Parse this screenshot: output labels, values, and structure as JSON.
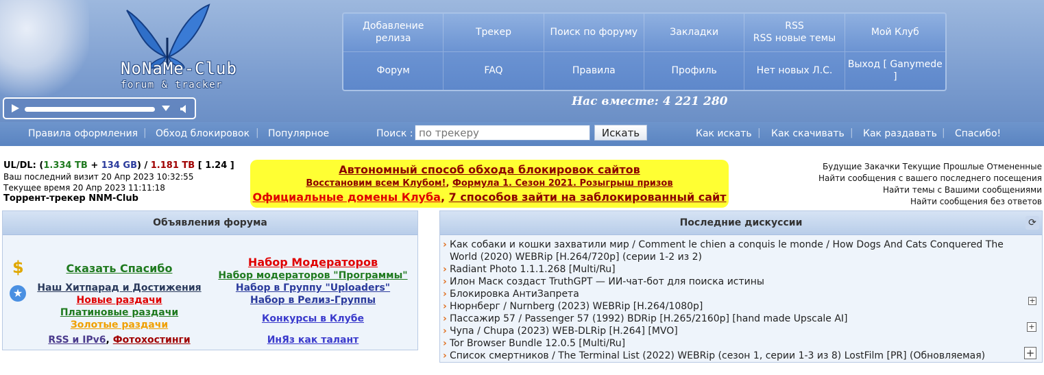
{
  "logo": {
    "title": "NoNaMe-Club",
    "subtitle": "forum & tracker"
  },
  "nav": [
    {
      "label": "Добавление релиза"
    },
    {
      "label": "Трекер"
    },
    {
      "label": "Поиск по форуму"
    },
    {
      "label": "Закладки"
    },
    {
      "label": "RSS\nRSS новые темы"
    },
    {
      "label": "Мой Клуб"
    },
    {
      "label": "Форум"
    },
    {
      "label": "FAQ"
    },
    {
      "label": "Правила"
    },
    {
      "label": "Профиль"
    },
    {
      "label": "Нет новых Л.С."
    },
    {
      "label": "Выход [ Ganymede ]"
    }
  ],
  "together": "Нас вместе: 4 221 280",
  "subbar": {
    "links_left": [
      "Правила оформления",
      "Обход блокировок",
      "Популярное"
    ],
    "search_label": "Поиск :",
    "search_placeholder": "по трекеру",
    "search_button": "Искать",
    "links_right": [
      "Как искать",
      "Как скачивать",
      "Как раздавать",
      "Спасибо!"
    ]
  },
  "user": {
    "ratio_label": "UL/DL:",
    "ul": "1.334 TB",
    "plus": "+",
    "bonus": "134 GB",
    "dl": "1.181 TB",
    "ratio": "1.24",
    "last_visit": "Ваш последний визит 20 Апр 2023 10:32:55",
    "current_time": "Текущее время 20 Апр 2023 11:11:18",
    "tracker_name": "Торрент-трекер NNM-Club"
  },
  "banner": {
    "line1": "Автономный способ обхода блокировок сайтов",
    "line2a": "Восстановим всем Клубом!",
    "line2b": "Формула 1. Сезон 2021. Розыгрыш призов",
    "line3a": "Официальные домены Клуба",
    "line3b": "7 способов зайти на заблокированный сайт"
  },
  "right_links": {
    "downloads": [
      "Будущие Закачки",
      "Текущие",
      "Прошлые",
      "Отмененные"
    ],
    "line2": "Найти сообщения с вашего последнего посещения",
    "line3": "Найти темы с Вашими сообщениями",
    "line4": "Найти сообщения без ответов"
  },
  "announce": {
    "title": "Объявления форума",
    "left": [
      {
        "text": "Сказать Спасибо",
        "color": "#1f7a1f"
      },
      {
        "text": "Наш Хитпарад и Достижения",
        "color": "#2a3a5c"
      },
      {
        "text": "Новые раздачи",
        "color": "#e00000"
      },
      {
        "text": "Платиновые раздачи",
        "color": "#1f7a1f"
      },
      {
        "text": "Золотые раздачи",
        "color": "#f0a000"
      },
      {
        "text": "RSS и IPv6",
        "color": "#4a3a8c"
      },
      {
        "text": "Фотохостинги",
        "color": "#a00000"
      }
    ],
    "right": [
      {
        "text": "Набор Модераторов",
        "color": "#e00000"
      },
      {
        "text": "Набор модераторов \"Программы\"",
        "color": "#1f7a1f"
      },
      {
        "text": "Набор в Группу \"Uploaders\"",
        "color": "#2a3a9c"
      },
      {
        "text": "Набор в Релиз-Группы",
        "color": "#2a3a9c"
      },
      {
        "text": "Конкурсы в Клубе",
        "color": "#3a3acc"
      },
      {
        "text": "ИнЯз как талант",
        "color": "#3a3acc"
      }
    ],
    "separator": ","
  },
  "discuss": {
    "title": "Последние дискуссии",
    "items": [
      "Как собаки и кошки захватили мир / Comment le chien a conquis le monde / How Dogs And Cats Conquered The World (2020) WEBRip [H.264/720p] (серии 1-2 из 2)",
      "Radiant Photo 1.1.1.268 [Multi/Ru]",
      "Илон Маск создаст TruthGPT — ИИ-чат-бот для поиска истины",
      "Блокировка АнтиЗапрета",
      "Нюрнберг / Nurnberg (2023) WEBRip [H.264/1080p]",
      "Пассажир 57 / Passenger 57 (1992) BDRip [H.265/2160p] [hand made Upscale AI]",
      "Чупа / Chupa (2023) WEB-DLRip [H.264] [MVO]",
      "Tor Browser Bundle 12.0.5 [Multi/Ru]",
      "Список смертников / The Terminal List (2022) WEBRip (сезон 1, серии 1-3 из 8) LostFilm [PR] (Обновляемая)"
    ]
  }
}
